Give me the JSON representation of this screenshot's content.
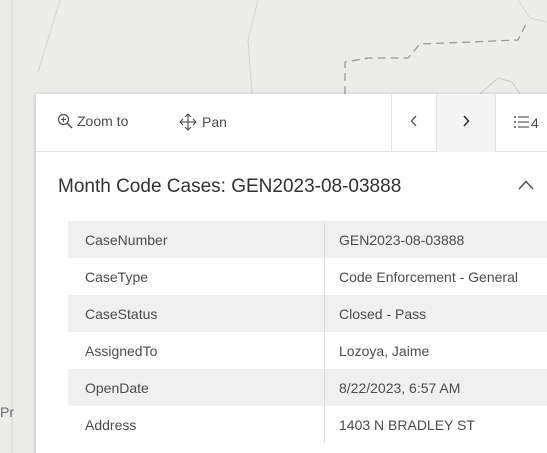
{
  "map": {
    "partial_label": "Pr"
  },
  "toolbar": {
    "zoom_label": "Zoom to",
    "pan_label": "Pan",
    "list_count": "4"
  },
  "popup": {
    "title": "Month Code Cases: GEN2023-08-03888",
    "fields": [
      {
        "key": "CaseNumber",
        "value": "GEN2023-08-03888"
      },
      {
        "key": "CaseType",
        "value": "Code Enforcement - General"
      },
      {
        "key": "CaseStatus",
        "value": "Closed - Pass"
      },
      {
        "key": "AssignedTo",
        "value": "Lozoya, Jaime"
      },
      {
        "key": "OpenDate",
        "value": "8/22/2023, 6:57 AM"
      },
      {
        "key": "Address",
        "value": "1403 N BRADLEY ST"
      }
    ]
  },
  "colors": {
    "icon": "#4c4c4c",
    "map_bg": "#ececea",
    "row_alt": "#f0f0f0"
  }
}
